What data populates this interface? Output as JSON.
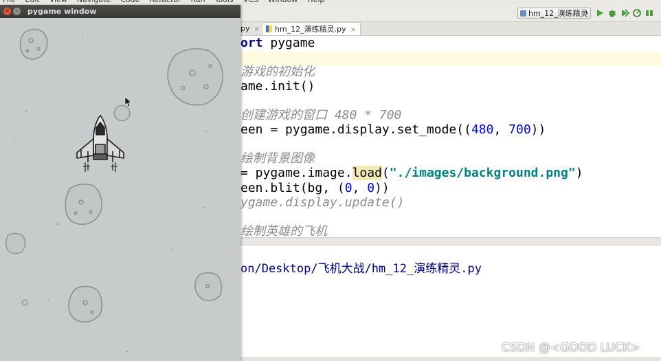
{
  "menu": [
    "File",
    "Edit",
    "View",
    "Navigate",
    "Code",
    "Refactor",
    "Run",
    "Tools",
    "VCS",
    "Window",
    "Help"
  ],
  "toolbar": {
    "run_config": "hm_12_演练精灵"
  },
  "tabs": [
    {
      "label": "py",
      "active": false
    },
    {
      "label": "hm_12_演练精灵.py",
      "active": true
    }
  ],
  "editor": {
    "lines": [
      {
        "parts": [
          {
            "t": "ort",
            "c": "k"
          },
          {
            "t": " pygame",
            "c": ""
          }
        ]
      },
      {
        "parts": [
          {
            "t": "",
            "c": ""
          }
        ]
      },
      {
        "parts": [
          {
            "t": "游戏的初始化",
            "c": "c"
          }
        ]
      },
      {
        "parts": [
          {
            "t": "ame.init()",
            "c": ""
          }
        ]
      },
      {
        "parts": [
          {
            "t": "",
            "c": ""
          }
        ]
      },
      {
        "parts": [
          {
            "t": "创建游戏的窗口 480 * 700",
            "c": "c"
          }
        ]
      },
      {
        "parts": [
          {
            "t": "een = pygame.display.set_mode((",
            "c": ""
          },
          {
            "t": "480",
            "c": "n"
          },
          {
            "t": ", ",
            "c": ""
          },
          {
            "t": "700",
            "c": "n"
          },
          {
            "t": "))",
            "c": ""
          }
        ]
      },
      {
        "parts": [
          {
            "t": "",
            "c": ""
          }
        ]
      },
      {
        "parts": [
          {
            "t": "绘制背景图像",
            "c": "c"
          }
        ]
      },
      {
        "parts": [
          {
            "t": "= pygame.image.",
            "c": ""
          },
          {
            "t": "load",
            "c": "fn-hl"
          },
          {
            "t": "(",
            "c": ""
          },
          {
            "t": "\"./images/background.png\"",
            "c": "s"
          },
          {
            "t": ")",
            "c": ""
          }
        ]
      },
      {
        "parts": [
          {
            "t": "een.blit(bg, (",
            "c": ""
          },
          {
            "t": "0",
            "c": "n"
          },
          {
            "t": ", ",
            "c": ""
          },
          {
            "t": "0",
            "c": "n"
          },
          {
            "t": "))",
            "c": ""
          }
        ]
      },
      {
        "parts": [
          {
            "t": "ygame.display.update()",
            "c": "c"
          }
        ]
      },
      {
        "parts": [
          {
            "t": "",
            "c": ""
          }
        ]
      },
      {
        "parts": [
          {
            "t": "绘制英雄的飞机",
            "c": "c"
          }
        ]
      }
    ]
  },
  "console": {
    "path": "on/Desktop/飞机大战/hm_12_演练精灵.py"
  },
  "pygame_window": {
    "title": "pygame window",
    "close_glyph": "×",
    "minimize_glyph": "–"
  },
  "watermark": "CSDN @<GOOD LUCK>",
  "colors": {
    "background": "#c7cbcb",
    "comment": "#8c8c8c",
    "number": "#0000ff",
    "string": "#008080"
  }
}
